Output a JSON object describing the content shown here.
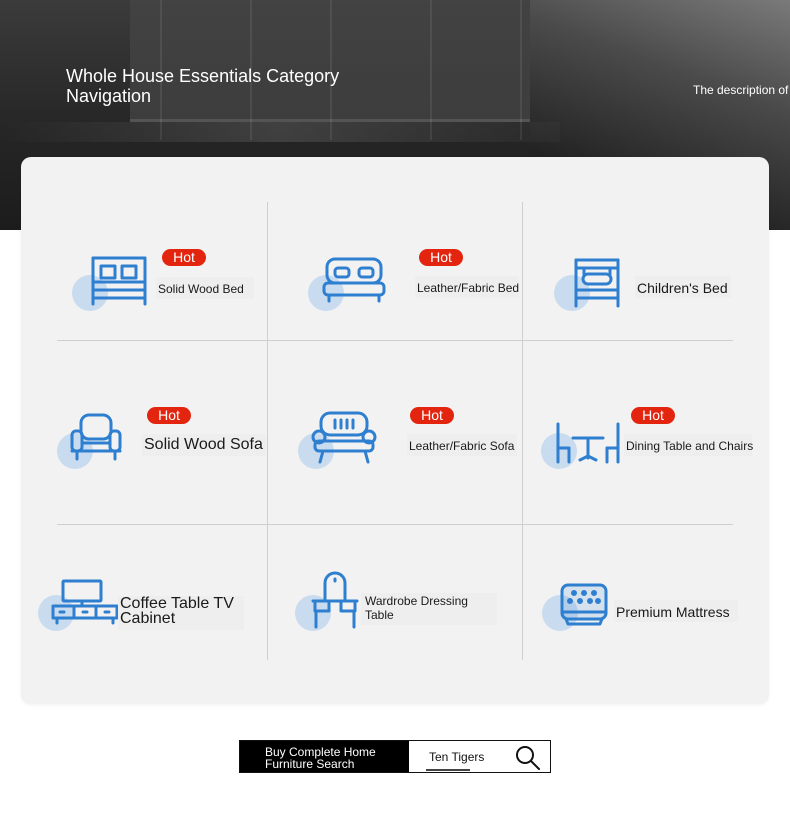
{
  "hero": {
    "title": "Whole House Essentials Category Navigation",
    "description": "The description of"
  },
  "categories": [
    {
      "label": "Solid Wood Bed",
      "hot": true,
      "icon": "bed-icon"
    },
    {
      "label": "Leather/Fabric Bed",
      "hot": true,
      "icon": "soft-bed-icon"
    },
    {
      "label": "Children's Bed",
      "hot": false,
      "icon": "childrens-bed-icon"
    },
    {
      "label": "Solid Wood Sofa",
      "hot": true,
      "icon": "armchair-icon"
    },
    {
      "label": "Leather/Fabric Sofa",
      "hot": true,
      "icon": "sofa-icon"
    },
    {
      "label": "Dining Table and Chairs",
      "hot": true,
      "icon": "dining-set-icon"
    },
    {
      "label": "Coffee Table TV Cabinet",
      "hot": false,
      "icon": "tv-cabinet-icon"
    },
    {
      "label": "Wardrobe Dressing Table",
      "hot": false,
      "icon": "dressing-table-icon"
    },
    {
      "label": "Premium Mattress",
      "hot": false,
      "icon": "mattress-icon"
    }
  ],
  "hot_badge": "Hot",
  "search": {
    "label": "Buy Complete Home Furniture Search",
    "placeholder": "Ten Tigers",
    "icon": "search-icon"
  },
  "colors": {
    "icon_blue": "#2f7fd0",
    "icon_circle": "#c9dbef",
    "hot_red": "#e3250f",
    "panel_bg": "#f2f2f2"
  }
}
